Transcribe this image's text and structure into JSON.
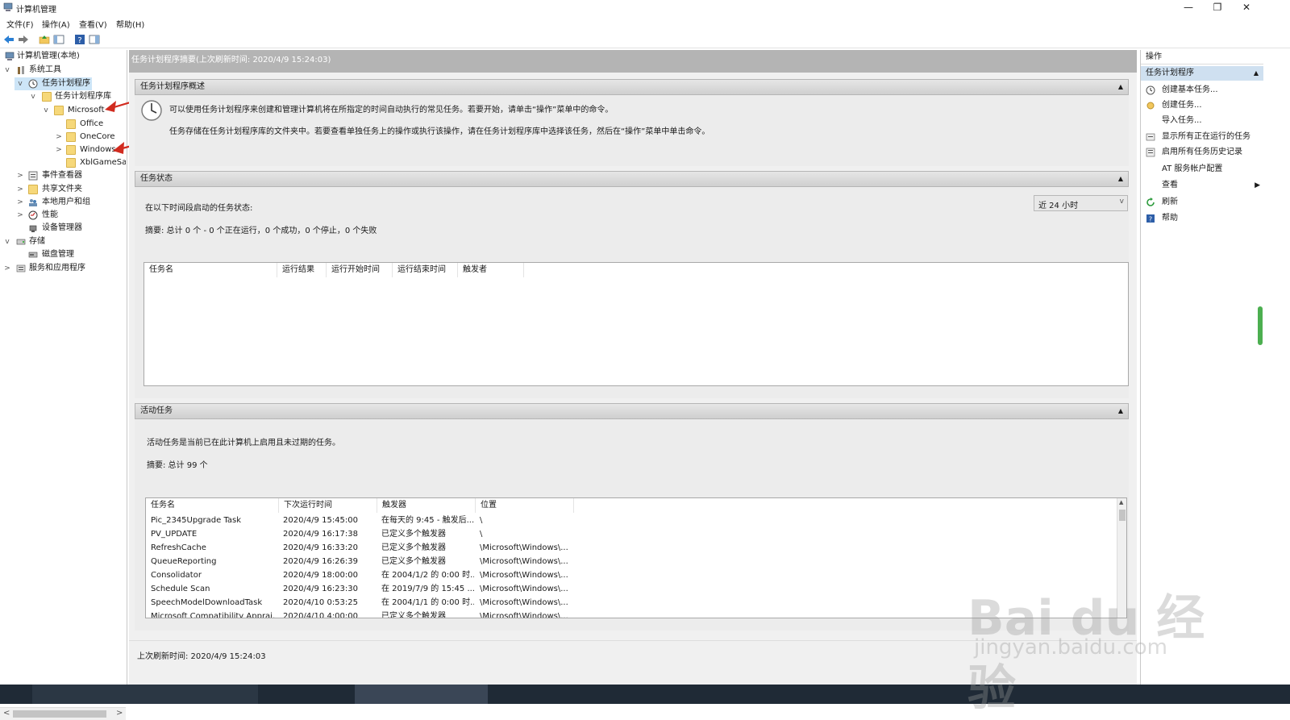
{
  "window": {
    "title": "计算机管理",
    "buttons": [
      "—",
      "❐",
      "✕"
    ]
  },
  "menu": [
    "文件(F)",
    "操作(A)",
    "查看(V)",
    "帮助(H)"
  ],
  "tree": {
    "root": "计算机管理(本地)",
    "system_tools": "系统工具",
    "task_scheduler": "任务计划程序",
    "task_library": "任务计划程序库",
    "microsoft": "Microsoft",
    "office": "Office",
    "onecore": "OneCore",
    "windows": "Windows",
    "xbl": "XblGameSa",
    "event_viewer": "事件查看器",
    "shared_folders": "共享文件夹",
    "local_users": "本地用户和组",
    "performance": "性能",
    "device_manager": "设备管理器",
    "storage": "存储",
    "disk_mgmt": "磁盘管理",
    "services": "服务和应用程序"
  },
  "center": {
    "header": "任务计划程序摘要(上次刷新时间: 2020/4/9 15:24:03)",
    "overview": {
      "title": "任务计划程序概述",
      "line1": "可以使用任务计划程序来创建和管理计算机将在所指定的时间自动执行的常见任务。若要开始，请单击“操作”菜单中的命令。",
      "line2": "任务存储在任务计划程序库的文件夹中。若要查看单独任务上的操作或执行该操作，请在任务计划程序库中选择该任务，然后在“操作”菜单中单击命令。"
    },
    "status": {
      "title": "任务状态",
      "prompt": "在以下时间段启动的任务状态:",
      "period": "近 24 小时",
      "summary": "摘要: 总计 0 个 - 0 个正在运行，0 个成功，0 个停止，0 个失败",
      "columns": [
        "任务名",
        "运行结果",
        "运行开始时间",
        "运行结束时间",
        "触发者"
      ]
    },
    "active": {
      "title": "活动任务",
      "desc": "活动任务是当前已在此计算机上启用且未过期的任务。",
      "summary": "摘要: 总计 99 个",
      "columns": [
        "任务名",
        "下次运行时间",
        "触发器",
        "位置"
      ],
      "rows": [
        {
          "name": "Pic_2345Upgrade Task",
          "next": "2020/4/9 15:45:00",
          "trigger": "在每天的 9:45 - 触发后...",
          "location": "\\"
        },
        {
          "name": "PV_UPDATE",
          "next": "2020/4/9 16:17:38",
          "trigger": "已定义多个触发器",
          "location": "\\"
        },
        {
          "name": "RefreshCache",
          "next": "2020/4/9 16:33:20",
          "trigger": "已定义多个触发器",
          "location": "\\Microsoft\\Windows\\..."
        },
        {
          "name": "QueueReporting",
          "next": "2020/4/9 16:26:39",
          "trigger": "已定义多个触发器",
          "location": "\\Microsoft\\Windows\\..."
        },
        {
          "name": "Consolidator",
          "next": "2020/4/9 18:00:00",
          "trigger": "在 2004/1/2 的 0:00 时...",
          "location": "\\Microsoft\\Windows\\..."
        },
        {
          "name": "Schedule Scan",
          "next": "2020/4/9 16:23:30",
          "trigger": "在 2019/7/9 的 15:45 ...",
          "location": "\\Microsoft\\Windows\\..."
        },
        {
          "name": "SpeechModelDownloadTask",
          "next": "2020/4/10 0:53:25",
          "trigger": "在 2004/1/1 的 0:00 时...",
          "location": "\\Microsoft\\Windows\\..."
        },
        {
          "name": "Microsoft Compatibility Apprai...",
          "next": "2020/4/10 4:00:00",
          "trigger": "已定义多个触发器",
          "location": "\\Microsoft\\Windows\\..."
        }
      ]
    },
    "footer": "上次刷新时间: 2020/4/9 15:24:03"
  },
  "actions": {
    "title": "操作",
    "section": "任务计划程序",
    "items": [
      "创建基本任务...",
      "创建任务...",
      "导入任务...",
      "显示所有正在运行的任务",
      "启用所有任务历史记录",
      "AT 服务帐户配置",
      "查看",
      "刷新",
      "帮助"
    ]
  },
  "watermark": {
    "brand": "Bai du 经验",
    "url": "jingyan.baidu.com"
  }
}
